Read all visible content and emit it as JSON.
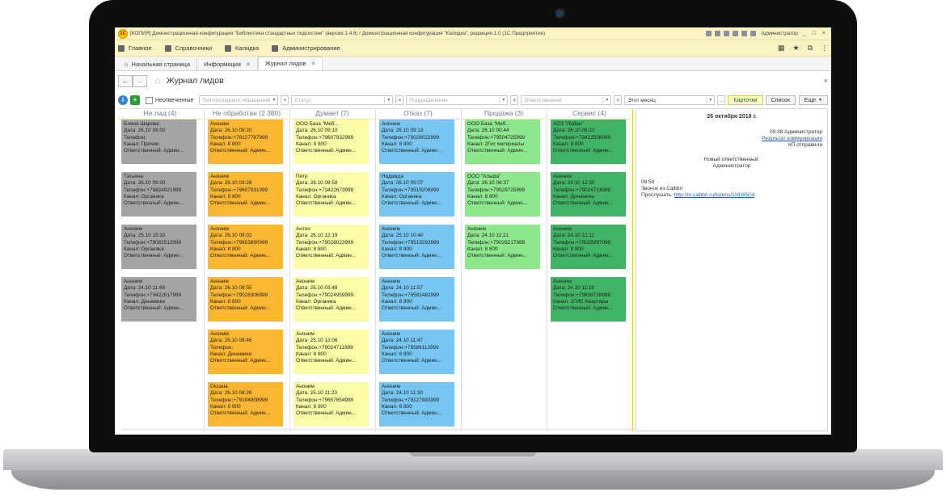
{
  "window": {
    "title": "[КОПИЯ] Демонстрационная конфигурация \"Библиотека стандартных подсистем\" (версия 2.4.6) / Демонстрационная конфигурация \"Калидка\", редакция 1.0   (1С:Предприятие)",
    "user": "Администратор",
    "controls": "_ □ ×"
  },
  "menu": {
    "items": [
      "Главное",
      "Справочники",
      "Калидка",
      "Администрирование"
    ]
  },
  "tabs": [
    {
      "label": "Начальная страница"
    },
    {
      "label": "Информация"
    },
    {
      "label": "Журнал лидов"
    }
  ],
  "page": {
    "title": "Журнал лидов",
    "back": "←",
    "forward": "→",
    "close": "×"
  },
  "filters": {
    "info_btn": "i",
    "add_btn": "+",
    "unanswered_label": "Неотвеченные",
    "last_contact_placeholder": "Тип последнего обращения",
    "status_placeholder": "Статус",
    "department_placeholder": "Подразделение",
    "responsible_placeholder": "Ответственный",
    "period_value": "Этот месяц",
    "cards_btn": "Карточки",
    "list_btn": "Список",
    "more_btn": "Еще"
  },
  "columns": [
    {
      "title": "Не лид (4)",
      "cards": [
        {
          "lines": [
            "Елена Шарова",
            "Дата: 26.10 09:00",
            "Телефон:",
            "Канал: Прочие",
            "Ответственный: Админ..."
          ]
        },
        {
          "lines": [
            "Татьяна",
            "Дата: 26.10 09:00",
            "Телефон:+79824921999",
            "Канал: Органика",
            "Ответственный: Админ..."
          ]
        },
        {
          "lines": [
            "Аноним",
            "Дата: 25.10 10:33",
            "Телефон:+79082513999",
            "Канал: Органика",
            "Ответственный: Админ..."
          ]
        },
        {
          "lines": [
            "Аноним",
            "Дата: 24.10 11:49",
            "Телефон:+73422617999",
            "Канал: Динамика",
            "Ответственный: Админ..."
          ]
        }
      ]
    },
    {
      "title": "Не обработан (2 380)",
      "cards": [
        {
          "lines": [
            "Аноним",
            "Дата: 26.10 09:20",
            "Телефон:+79127787999",
            "Канал: 8 800",
            "Ответственный: Админ..."
          ]
        },
        {
          "lines": [
            "Аноним",
            "Дата: 26.10 09:28",
            "Телефон:+79607931999",
            "Канал: 8 800",
            "Ответственный: Админ..."
          ]
        },
        {
          "lines": [
            "Аноним",
            "Дата: 26.10 09:02",
            "Телефон:+79653890999",
            "Канал: 8 800",
            "Ответственный: Админ..."
          ]
        },
        {
          "lines": [
            "Аноним",
            "Дата: 26.10 08:55",
            "Телефон:+79028306999",
            "Канал: 8 800",
            "Ответственный: Админ..."
          ]
        },
        {
          "lines": [
            "Аноним",
            "Дата: 26.10 08:46",
            "Телефон:",
            "Канал: Динамика",
            "Ответственный: Админ..."
          ]
        },
        {
          "lines": [
            "Оксана",
            "Дата: 26.10 08:26",
            "Телефон:+79194908999",
            "Канал: 8 800",
            "Ответственный: Админ..."
          ]
        }
      ]
    },
    {
      "title": "Думает (7)",
      "cards": [
        {
          "lines": [
            "ООО База \"Меб...",
            "Дата: 26.10 09:10",
            "Телефон:+79607932999",
            "Канал: 8 800",
            "Ответственный: Админ..."
          ]
        },
        {
          "lines": [
            "Петр",
            "Дата: 26.10 08:59",
            "Телефон:+73422673999",
            "Канал: Органика",
            "Ответственный: Админ..."
          ]
        },
        {
          "lines": [
            "Антон",
            "Дата: 26.10 12:19",
            "Телефон:+79028023999",
            "Канал: 8 800",
            "Ответственный: Админ..."
          ]
        },
        {
          "lines": [
            "Аноним",
            "Дата: 25.10 03:48",
            "Телефон:+79024959999",
            "Канал: Органика",
            "Ответственный: Админ..."
          ]
        },
        {
          "lines": [
            "Аноним",
            "Дата: 25.10 12:06",
            "Телефон:+79024711999",
            "Канал: 8 800",
            "Ответственный: Админ..."
          ]
        },
        {
          "lines": [
            "Аноним",
            "Дата: 25.10 11:23",
            "Телефон:+79657854999",
            "Канал: 8 800",
            "Ответственный: Админ..."
          ]
        }
      ]
    },
    {
      "title": "Отказ (7)",
      "cards": [
        {
          "lines": [
            "Аноним",
            "Дата: 26.10 09:13",
            "Телефон:+79028022999",
            "Канал: 8 800",
            "Ответственный: Админ..."
          ]
        },
        {
          "lines": [
            "Надежда",
            "Дата: 26.10 09:07",
            "Телефон:+79519206999",
            "Канал: Органика",
            "Ответственный: Админ..."
          ]
        },
        {
          "lines": [
            "Аноним",
            "Дата: 25.10 10:40",
            "Телефон:+79519292999",
            "Канал: 8 800",
            "Ответственный: Админ..."
          ]
        },
        {
          "lines": [
            "Аноним",
            "Дата: 24.10 11:57",
            "Телефон:+79581482999",
            "Канал: 8 800",
            "Ответственный: Админ..."
          ]
        },
        {
          "lines": [
            "Аноним",
            "Дата: 24.10 11:47",
            "Телефон:+79586113999",
            "Канал: 8 800",
            "Ответственный: Админ..."
          ]
        },
        {
          "lines": [
            "Аноним",
            "Дата: 24.10 11:30",
            "Телефон:+79127883999",
            "Канал: 8 800",
            "Ответственный: Админ..."
          ]
        }
      ]
    },
    {
      "title": "Продажа (3)",
      "cards": [
        {
          "lines": [
            "ООО База \"Меб...",
            "Дата: 26.10 00:44",
            "Телефон:+79504725999",
            "Канал: 2Гис материалы",
            "Ответственный: Админ..."
          ]
        },
        {
          "lines": [
            "ООО \"Альфа\"",
            "Дата: 26.10 08:37",
            "Телефон:+79529725999",
            "Канал: 8 800",
            "Ответственный: Админ..."
          ]
        },
        {
          "lines": [
            "Аноним",
            "Дата: 24.10 11:21",
            "Телефон:+79028217999",
            "Канал: 8 800",
            "Ответственный: Админ..."
          ]
        }
      ]
    },
    {
      "title": "Сервис (4)",
      "cards": [
        {
          "lines": [
            "АОЗ \"Лабан\"",
            "Дата: 26.10 09:22",
            "Телефон:+73422508999",
            "Канал: 8 800",
            "Ответственный: Админ..."
          ]
        },
        {
          "lines": [
            "Аноним",
            "Дата: 24.10 12:30",
            "Телефон:+79024713999",
            "Канал: Динамика",
            "Ответственный: Админ..."
          ]
        },
        {
          "lines": [
            "Аноним",
            "Дата: 24.10 12:11",
            "Телефон:+79028397999",
            "Канал: 8 800",
            "Ответственный: Админ..."
          ]
        },
        {
          "lines": [
            "Аноним",
            "Дата: 24.10 11:19",
            "Телефон:+79638728999",
            "Канал: 2ГИС Квартиры",
            "Ответственный: Админ..."
          ]
        }
      ]
    }
  ],
  "colors": {
    "gray": "#a3a4a6",
    "orange": "#fbb731",
    "yellow": "#fafca6",
    "blue": "#77c6f2",
    "light_green": "#8de88d",
    "dark_green": "#41b364"
  },
  "detail": {
    "date": "26 октября 2018 г.",
    "entry1_time_user": "09:38 Администратор",
    "entry1_link": "Результат коммуникации",
    "entry1_text": "КП отправили",
    "entry2_line1": "Новый ответственный:",
    "entry2_line2": "Администратор",
    "entry3_time": "08:59",
    "entry3_text": "Звонок из Callibri",
    "entry3_listen_label": "Прослушать:",
    "entry3_link": "http://in.callibri.ru/listens/11938504"
  }
}
